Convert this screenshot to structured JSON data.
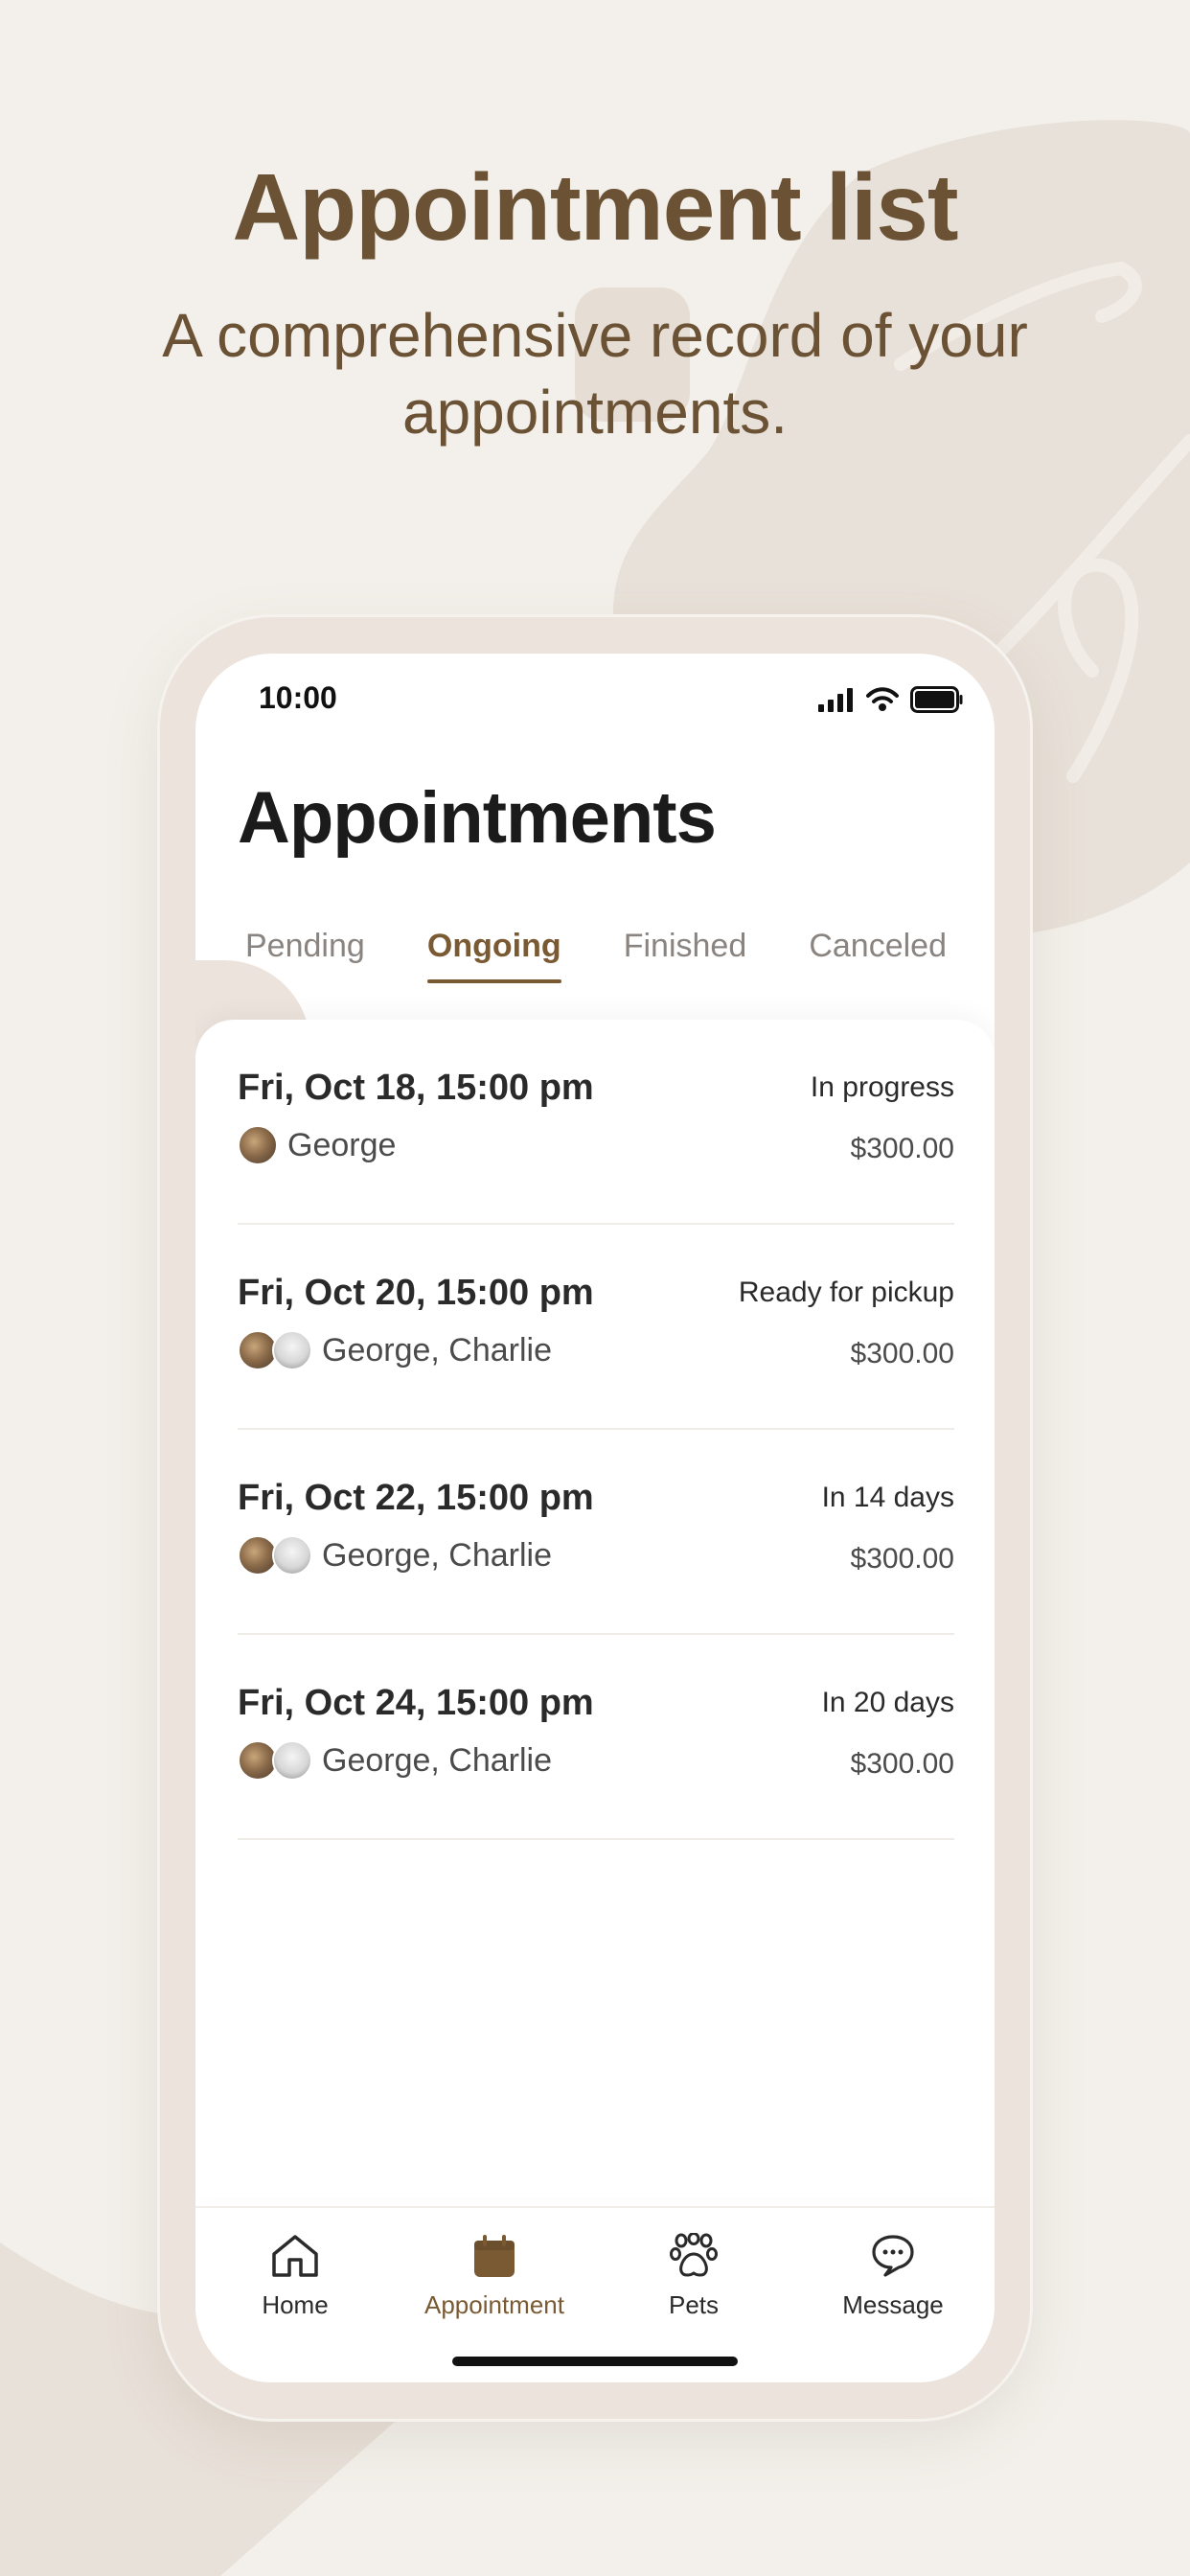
{
  "hero": {
    "title": "Appointment list",
    "subtitle": "A comprehensive record of your appointments."
  },
  "status_bar": {
    "time": "10:00",
    "icons": [
      "signal-icon",
      "wifi-icon",
      "battery-icon"
    ]
  },
  "page": {
    "title": "Appointments"
  },
  "tabs": [
    {
      "label": "Pending",
      "active": false
    },
    {
      "label": "Ongoing",
      "active": true
    },
    {
      "label": "Finished",
      "active": false
    },
    {
      "label": "Canceled",
      "active": false
    }
  ],
  "appointments": [
    {
      "date": "Fri, Oct 18, 15:00 pm",
      "status": "In progress",
      "pets": "George",
      "price": "$300.00",
      "avatars": [
        "cat"
      ]
    },
    {
      "date": "Fri, Oct 20, 15:00 pm",
      "status": "Ready for pickup",
      "pets": "George, Charlie",
      "price": "$300.00",
      "avatars": [
        "cat",
        "dog"
      ]
    },
    {
      "date": "Fri, Oct 22, 15:00 pm",
      "status": "In 14 days",
      "pets": "George, Charlie",
      "price": "$300.00",
      "avatars": [
        "cat",
        "dog"
      ]
    },
    {
      "date": "Fri, Oct 24, 15:00 pm",
      "status": "In 20 days",
      "pets": "George, Charlie",
      "price": "$300.00",
      "avatars": [
        "cat",
        "dog"
      ]
    }
  ],
  "tabbar": [
    {
      "label": "Home",
      "icon": "home-icon",
      "active": false
    },
    {
      "label": "Appointment",
      "icon": "calendar-icon",
      "active": true
    },
    {
      "label": "Pets",
      "icon": "paw-icon",
      "active": false
    },
    {
      "label": "Message",
      "icon": "chat-bubble-icon",
      "active": false
    }
  ],
  "colors": {
    "background": "#f3f0eb",
    "accent": "#7a5a33",
    "hero_text": "#6b5235",
    "phone_frame": "#ebe3dc"
  }
}
